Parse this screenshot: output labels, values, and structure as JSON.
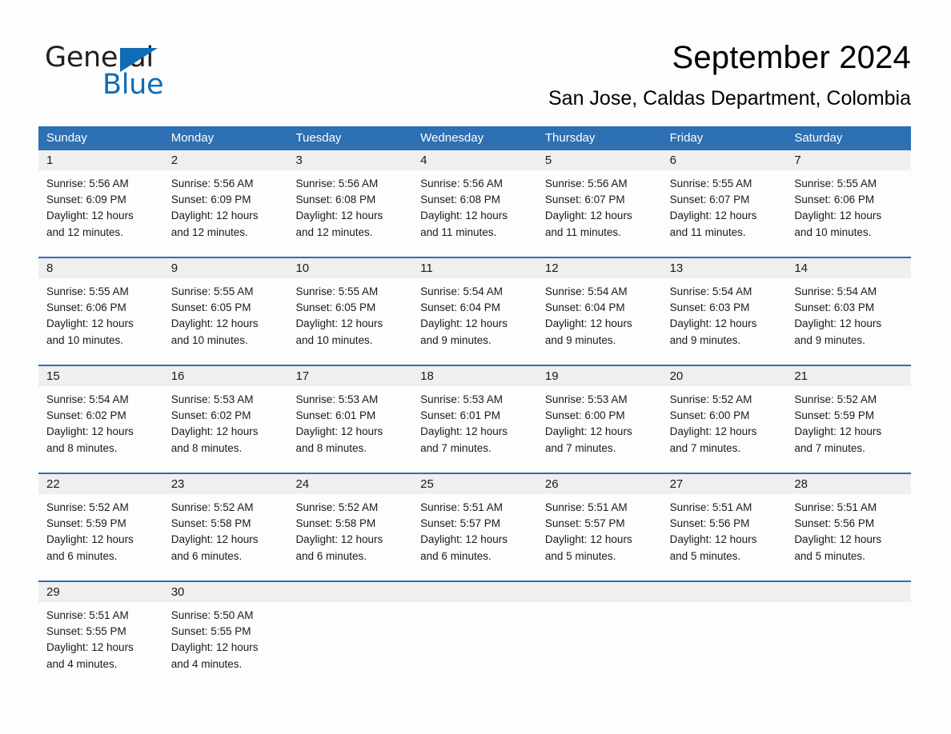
{
  "brand": {
    "name_part1": "General",
    "name_part2": "Blue",
    "triangle_icon": "blue-triangle-logo-icon",
    "accent_color": "#0f6cb5"
  },
  "header": {
    "month_title": "September 2024",
    "location": "San Jose, Caldas Department, Colombia"
  },
  "theme": {
    "header_blue": "#2d70b3",
    "day_band_gray": "#efefef",
    "page_background": "#fdfdfd",
    "text_color": "#1a1a1a"
  },
  "weekdays": [
    "Sunday",
    "Monday",
    "Tuesday",
    "Wednesday",
    "Thursday",
    "Friday",
    "Saturday"
  ],
  "weeks": [
    [
      {
        "day": "1",
        "sunrise": "Sunrise: 5:56 AM",
        "sunset": "Sunset: 6:09 PM",
        "daylight_line1": "Daylight: 12 hours",
        "daylight_line2": "and 12 minutes."
      },
      {
        "day": "2",
        "sunrise": "Sunrise: 5:56 AM",
        "sunset": "Sunset: 6:09 PM",
        "daylight_line1": "Daylight: 12 hours",
        "daylight_line2": "and 12 minutes."
      },
      {
        "day": "3",
        "sunrise": "Sunrise: 5:56 AM",
        "sunset": "Sunset: 6:08 PM",
        "daylight_line1": "Daylight: 12 hours",
        "daylight_line2": "and 12 minutes."
      },
      {
        "day": "4",
        "sunrise": "Sunrise: 5:56 AM",
        "sunset": "Sunset: 6:08 PM",
        "daylight_line1": "Daylight: 12 hours",
        "daylight_line2": "and 11 minutes."
      },
      {
        "day": "5",
        "sunrise": "Sunrise: 5:56 AM",
        "sunset": "Sunset: 6:07 PM",
        "daylight_line1": "Daylight: 12 hours",
        "daylight_line2": "and 11 minutes."
      },
      {
        "day": "6",
        "sunrise": "Sunrise: 5:55 AM",
        "sunset": "Sunset: 6:07 PM",
        "daylight_line1": "Daylight: 12 hours",
        "daylight_line2": "and 11 minutes."
      },
      {
        "day": "7",
        "sunrise": "Sunrise: 5:55 AM",
        "sunset": "Sunset: 6:06 PM",
        "daylight_line1": "Daylight: 12 hours",
        "daylight_line2": "and 10 minutes."
      }
    ],
    [
      {
        "day": "8",
        "sunrise": "Sunrise: 5:55 AM",
        "sunset": "Sunset: 6:06 PM",
        "daylight_line1": "Daylight: 12 hours",
        "daylight_line2": "and 10 minutes."
      },
      {
        "day": "9",
        "sunrise": "Sunrise: 5:55 AM",
        "sunset": "Sunset: 6:05 PM",
        "daylight_line1": "Daylight: 12 hours",
        "daylight_line2": "and 10 minutes."
      },
      {
        "day": "10",
        "sunrise": "Sunrise: 5:55 AM",
        "sunset": "Sunset: 6:05 PM",
        "daylight_line1": "Daylight: 12 hours",
        "daylight_line2": "and 10 minutes."
      },
      {
        "day": "11",
        "sunrise": "Sunrise: 5:54 AM",
        "sunset": "Sunset: 6:04 PM",
        "daylight_line1": "Daylight: 12 hours",
        "daylight_line2": "and 9 minutes."
      },
      {
        "day": "12",
        "sunrise": "Sunrise: 5:54 AM",
        "sunset": "Sunset: 6:04 PM",
        "daylight_line1": "Daylight: 12 hours",
        "daylight_line2": "and 9 minutes."
      },
      {
        "day": "13",
        "sunrise": "Sunrise: 5:54 AM",
        "sunset": "Sunset: 6:03 PM",
        "daylight_line1": "Daylight: 12 hours",
        "daylight_line2": "and 9 minutes."
      },
      {
        "day": "14",
        "sunrise": "Sunrise: 5:54 AM",
        "sunset": "Sunset: 6:03 PM",
        "daylight_line1": "Daylight: 12 hours",
        "daylight_line2": "and 9 minutes."
      }
    ],
    [
      {
        "day": "15",
        "sunrise": "Sunrise: 5:54 AM",
        "sunset": "Sunset: 6:02 PM",
        "daylight_line1": "Daylight: 12 hours",
        "daylight_line2": "and 8 minutes."
      },
      {
        "day": "16",
        "sunrise": "Sunrise: 5:53 AM",
        "sunset": "Sunset: 6:02 PM",
        "daylight_line1": "Daylight: 12 hours",
        "daylight_line2": "and 8 minutes."
      },
      {
        "day": "17",
        "sunrise": "Sunrise: 5:53 AM",
        "sunset": "Sunset: 6:01 PM",
        "daylight_line1": "Daylight: 12 hours",
        "daylight_line2": "and 8 minutes."
      },
      {
        "day": "18",
        "sunrise": "Sunrise: 5:53 AM",
        "sunset": "Sunset: 6:01 PM",
        "daylight_line1": "Daylight: 12 hours",
        "daylight_line2": "and 7 minutes."
      },
      {
        "day": "19",
        "sunrise": "Sunrise: 5:53 AM",
        "sunset": "Sunset: 6:00 PM",
        "daylight_line1": "Daylight: 12 hours",
        "daylight_line2": "and 7 minutes."
      },
      {
        "day": "20",
        "sunrise": "Sunrise: 5:52 AM",
        "sunset": "Sunset: 6:00 PM",
        "daylight_line1": "Daylight: 12 hours",
        "daylight_line2": "and 7 minutes."
      },
      {
        "day": "21",
        "sunrise": "Sunrise: 5:52 AM",
        "sunset": "Sunset: 5:59 PM",
        "daylight_line1": "Daylight: 12 hours",
        "daylight_line2": "and 7 minutes."
      }
    ],
    [
      {
        "day": "22",
        "sunrise": "Sunrise: 5:52 AM",
        "sunset": "Sunset: 5:59 PM",
        "daylight_line1": "Daylight: 12 hours",
        "daylight_line2": "and 6 minutes."
      },
      {
        "day": "23",
        "sunrise": "Sunrise: 5:52 AM",
        "sunset": "Sunset: 5:58 PM",
        "daylight_line1": "Daylight: 12 hours",
        "daylight_line2": "and 6 minutes."
      },
      {
        "day": "24",
        "sunrise": "Sunrise: 5:52 AM",
        "sunset": "Sunset: 5:58 PM",
        "daylight_line1": "Daylight: 12 hours",
        "daylight_line2": "and 6 minutes."
      },
      {
        "day": "25",
        "sunrise": "Sunrise: 5:51 AM",
        "sunset": "Sunset: 5:57 PM",
        "daylight_line1": "Daylight: 12 hours",
        "daylight_line2": "and 6 minutes."
      },
      {
        "day": "26",
        "sunrise": "Sunrise: 5:51 AM",
        "sunset": "Sunset: 5:57 PM",
        "daylight_line1": "Daylight: 12 hours",
        "daylight_line2": "and 5 minutes."
      },
      {
        "day": "27",
        "sunrise": "Sunrise: 5:51 AM",
        "sunset": "Sunset: 5:56 PM",
        "daylight_line1": "Daylight: 12 hours",
        "daylight_line2": "and 5 minutes."
      },
      {
        "day": "28",
        "sunrise": "Sunrise: 5:51 AM",
        "sunset": "Sunset: 5:56 PM",
        "daylight_line1": "Daylight: 12 hours",
        "daylight_line2": "and 5 minutes."
      }
    ],
    [
      {
        "day": "29",
        "sunrise": "Sunrise: 5:51 AM",
        "sunset": "Sunset: 5:55 PM",
        "daylight_line1": "Daylight: 12 hours",
        "daylight_line2": "and 4 minutes."
      },
      {
        "day": "30",
        "sunrise": "Sunrise: 5:50 AM",
        "sunset": "Sunset: 5:55 PM",
        "daylight_line1": "Daylight: 12 hours",
        "daylight_line2": "and 4 minutes."
      },
      {
        "day": "",
        "sunrise": "",
        "sunset": "",
        "daylight_line1": "",
        "daylight_line2": ""
      },
      {
        "day": "",
        "sunrise": "",
        "sunset": "",
        "daylight_line1": "",
        "daylight_line2": ""
      },
      {
        "day": "",
        "sunrise": "",
        "sunset": "",
        "daylight_line1": "",
        "daylight_line2": ""
      },
      {
        "day": "",
        "sunrise": "",
        "sunset": "",
        "daylight_line1": "",
        "daylight_line2": ""
      },
      {
        "day": "",
        "sunrise": "",
        "sunset": "",
        "daylight_line1": "",
        "daylight_line2": ""
      }
    ]
  ]
}
